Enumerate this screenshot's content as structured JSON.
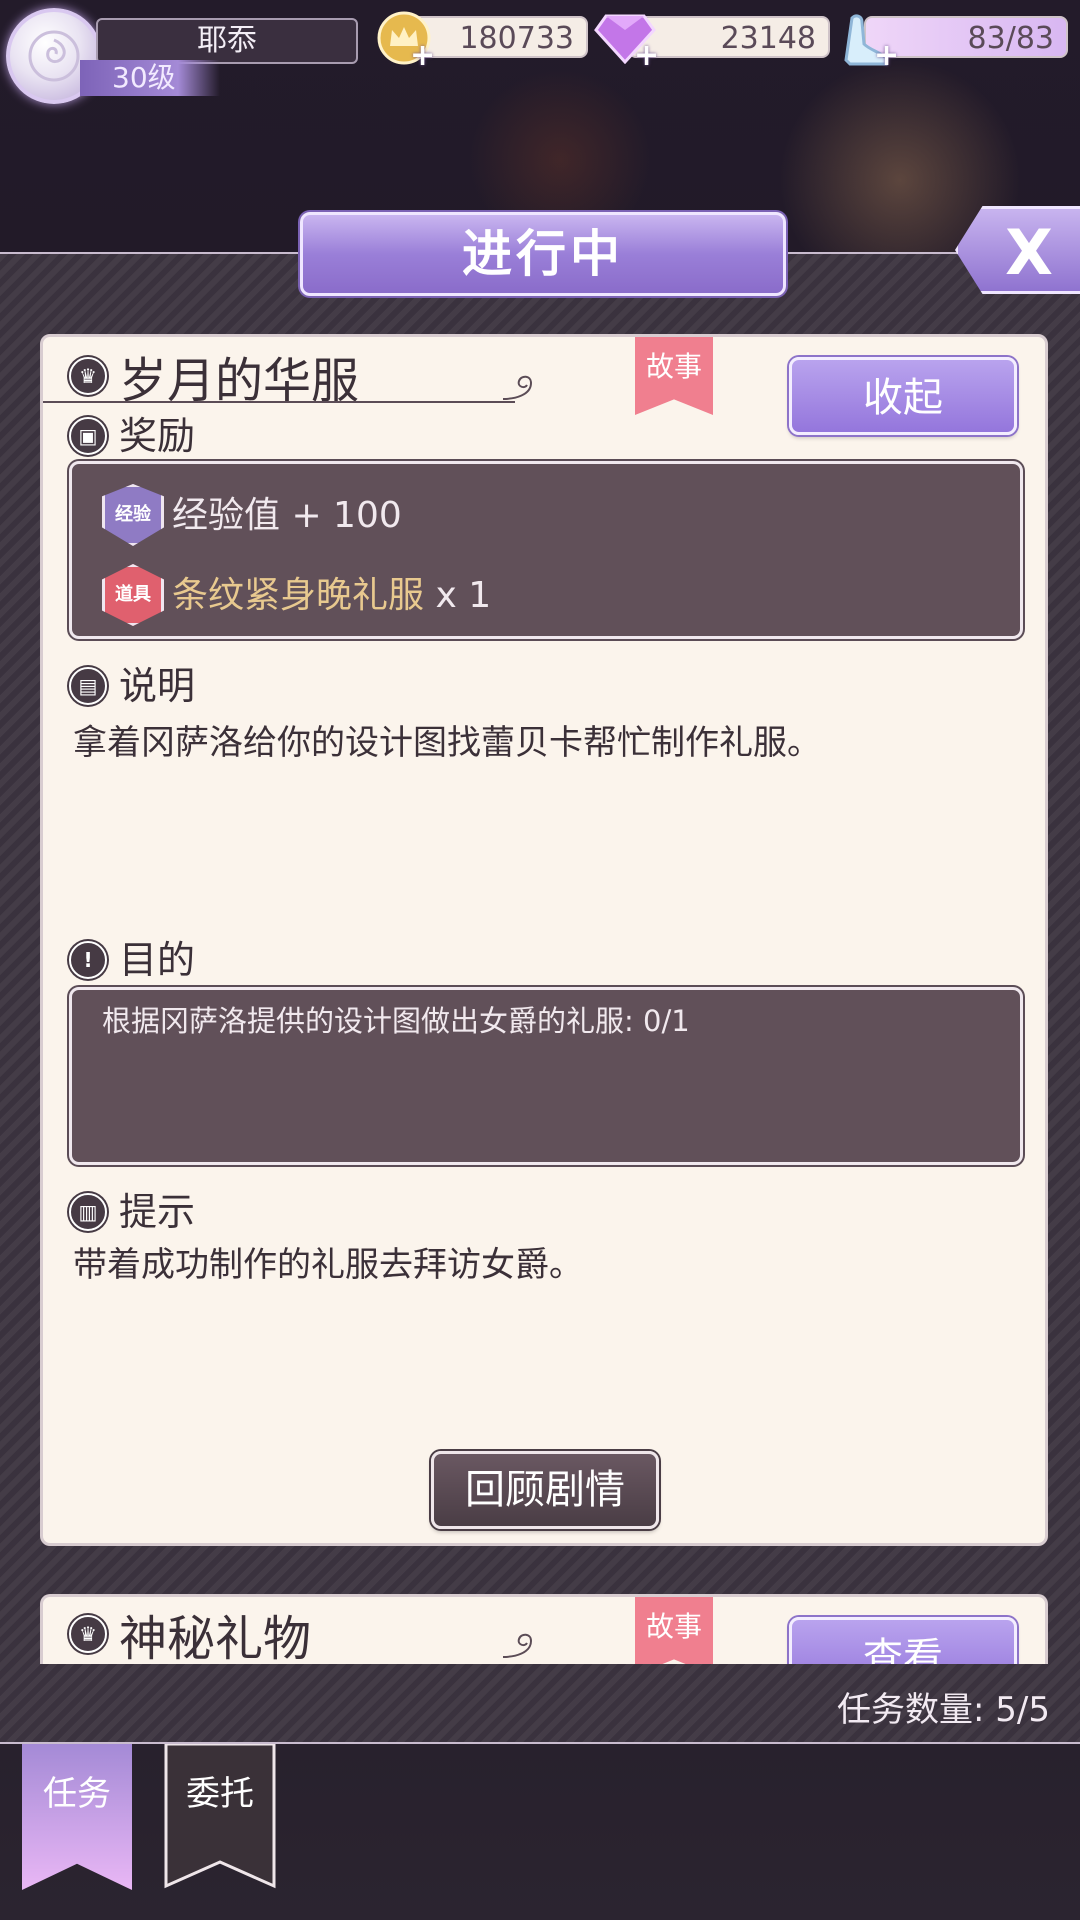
{
  "player": {
    "name": "耶忝",
    "level": "30级"
  },
  "resources": {
    "coins": "180733",
    "gems": "23148",
    "stamina": "83/83"
  },
  "header": {
    "title": "进行中",
    "close_label": "X"
  },
  "quest_1": {
    "title": "岁月的华服",
    "tag": "故事",
    "collapse_label": "收起",
    "reward_heading": "奖励",
    "rewards": [
      {
        "badge": "经验",
        "label": "经验值 + 100",
        "color": "#f1e9ee"
      },
      {
        "badge": "道具",
        "label": "条纹紧身晚礼服",
        "qty": " x 1",
        "color": "#e8c98f"
      }
    ],
    "description_heading": "说明",
    "description": "拿着冈萨洛给你的设计图找蕾贝卡帮忙制作礼服。",
    "objective_heading": "目的",
    "objective": "根据冈萨洛提供的设计图做出女爵的礼服: 0/1",
    "hint_heading": "提示",
    "hint": "带着成功制作的礼服去拜访女爵。",
    "review_label": "回顾剧情"
  },
  "quest_2": {
    "title": "神秘礼物",
    "tag": "故事",
    "view_label": "查看"
  },
  "footer": {
    "count": "任务数量: 5/5"
  },
  "tabs": [
    {
      "label": "任务",
      "active": true
    },
    {
      "label": "委托",
      "active": false
    }
  ],
  "colors": {
    "accent": "#9a7fd8",
    "tag": "#f07f8f",
    "card_bg": "#fbf4ec",
    "dark_box": "#615059"
  }
}
